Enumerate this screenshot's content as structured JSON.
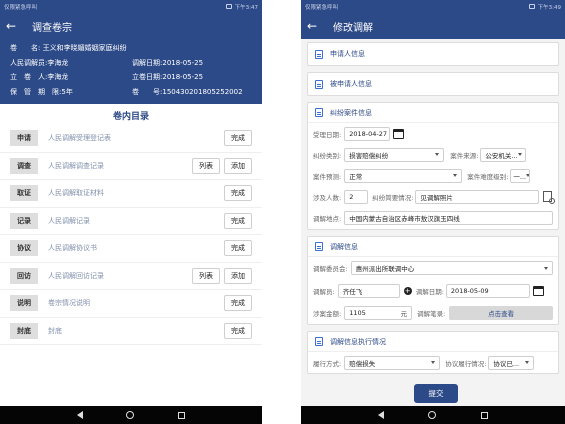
{
  "left": {
    "status": {
      "emergency": "仅限紧急呼叫",
      "time": "下午3:47"
    },
    "title": "调查卷宗",
    "info": {
      "case_name_label": "卷　　名:",
      "case_name": "王义和李晓媚婚姻家庭纠纷",
      "mediator_label": "人民调解员:",
      "mediator": "李海龙",
      "mediate_date_label": "调解日期:",
      "mediate_date": "2018-05-25",
      "filer_label": "立　卷　人:",
      "filer": "李海龙",
      "file_date_label": "立卷日期:",
      "file_date": "2018-05-25",
      "retention_label": "保　管　期　限:",
      "retention": "5年",
      "number_label": "卷　　号:",
      "number": "150430201805252002"
    },
    "toc_title": "卷内目录",
    "toc": [
      {
        "tag": "申请",
        "desc": "人民调解受理登记表",
        "list": "",
        "action": "完成"
      },
      {
        "tag": "调查",
        "desc": "人民调解调查记录",
        "list": "列表",
        "action": "添加"
      },
      {
        "tag": "取证",
        "desc": "人民调解取证材料",
        "list": "",
        "action": "完成"
      },
      {
        "tag": "记录",
        "desc": "人民调解记录",
        "list": "",
        "action": "完成"
      },
      {
        "tag": "协议",
        "desc": "人民调解协议书",
        "list": "",
        "action": "完成"
      },
      {
        "tag": "回访",
        "desc": "人民调解回访记录",
        "list": "列表",
        "action": "添加"
      },
      {
        "tag": "说明",
        "desc": "卷宗情况说明",
        "list": "",
        "action": "完成"
      },
      {
        "tag": "封底",
        "desc": "封底",
        "list": "",
        "action": "完成"
      }
    ]
  },
  "right": {
    "status": {
      "emergency": "仅限紧急呼叫",
      "time": "下午3:49"
    },
    "title": "修改调解",
    "applicant_section": "申请人信息",
    "respondent_section": "被申请人信息",
    "dispute": {
      "section": "纠纷案件信息",
      "accept_date_label": "受理日期:",
      "accept_date": "2018-04-27",
      "category_label": "纠纷类别:",
      "category": "损害赔偿纠纷",
      "source_label": "案件来源:",
      "source": "公安机关...",
      "forecast_label": "案件预测:",
      "forecast": "正常",
      "difficulty_label": "案件难度级别:",
      "difficulty": "一...",
      "people_label": "涉及人数:",
      "people": "2",
      "summary_label": "纠纷简要情况:",
      "summary": "见调解照片",
      "place_label": "调解地点:",
      "place": "中国内蒙古自治区赤峰市敖汉旗玉四线"
    },
    "mediation": {
      "section": "调解信息",
      "committee_label": "调解委员会:",
      "committee": "惠州派出所联调中心",
      "mediator_label": "调解员:",
      "mediator": "齐任飞",
      "date_label": "调解日期:",
      "date": "2018-05-09",
      "amount_label": "涉案金额:",
      "amount": "1105",
      "amount_unit": "元",
      "record_label": "调解笔录:",
      "record_button": "点击查看"
    },
    "execution": {
      "section": "调解信息执行情况",
      "method_label": "履行方式:",
      "method": "赔偿损失",
      "status_label": "协议履行情况:",
      "status": "协议已..."
    },
    "submit": "提交"
  }
}
